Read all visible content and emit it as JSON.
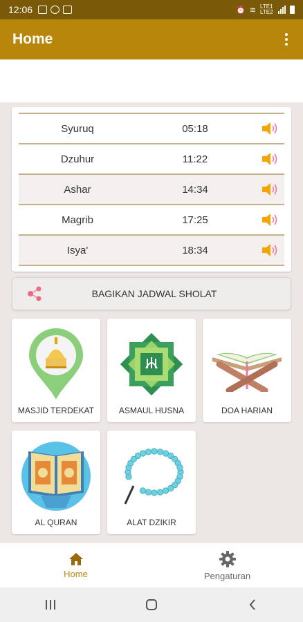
{
  "status": {
    "time": "12:06",
    "right_text": "LTE1 LTE2"
  },
  "app_bar": {
    "title": "Home",
    "more_icon": "more-vert-icon"
  },
  "prayers": [
    {
      "name": "Syuruq",
      "time": "05:18",
      "icon": "speaker-icon"
    },
    {
      "name": "Dzuhur",
      "time": "11:22",
      "icon": "speaker-icon"
    },
    {
      "name": "Ashar",
      "time": "14:34",
      "icon": "speaker-icon"
    },
    {
      "name": "Magrib",
      "time": "17:25",
      "icon": "speaker-icon"
    },
    {
      "name": "Isya'",
      "time": "18:34",
      "icon": "speaker-icon"
    }
  ],
  "share": {
    "label": "BAGIKAN JADWAL SHOLAT",
    "icon": "share-icon"
  },
  "menu": [
    {
      "label": "MASJID TERDEKAT",
      "icon": "mosque-pin-icon"
    },
    {
      "label": "ASMAUL HUSNA",
      "icon": "asmaul-husna-icon"
    },
    {
      "label": "DOA HARIAN",
      "icon": "book-stand-icon"
    },
    {
      "label": "AL QURAN",
      "icon": "quran-icon"
    },
    {
      "label": "ALAT DZIKIR",
      "icon": "prayer-beads-icon"
    }
  ],
  "bottom_nav": [
    {
      "label": "Home",
      "icon": "home-icon"
    },
    {
      "label": "Pengaturan",
      "icon": "gear-icon"
    }
  ],
  "colors": {
    "accent": "#b8860b",
    "status_bar": "#7a5a08",
    "divider": "#c5b390",
    "speaker": "#f5a500"
  }
}
